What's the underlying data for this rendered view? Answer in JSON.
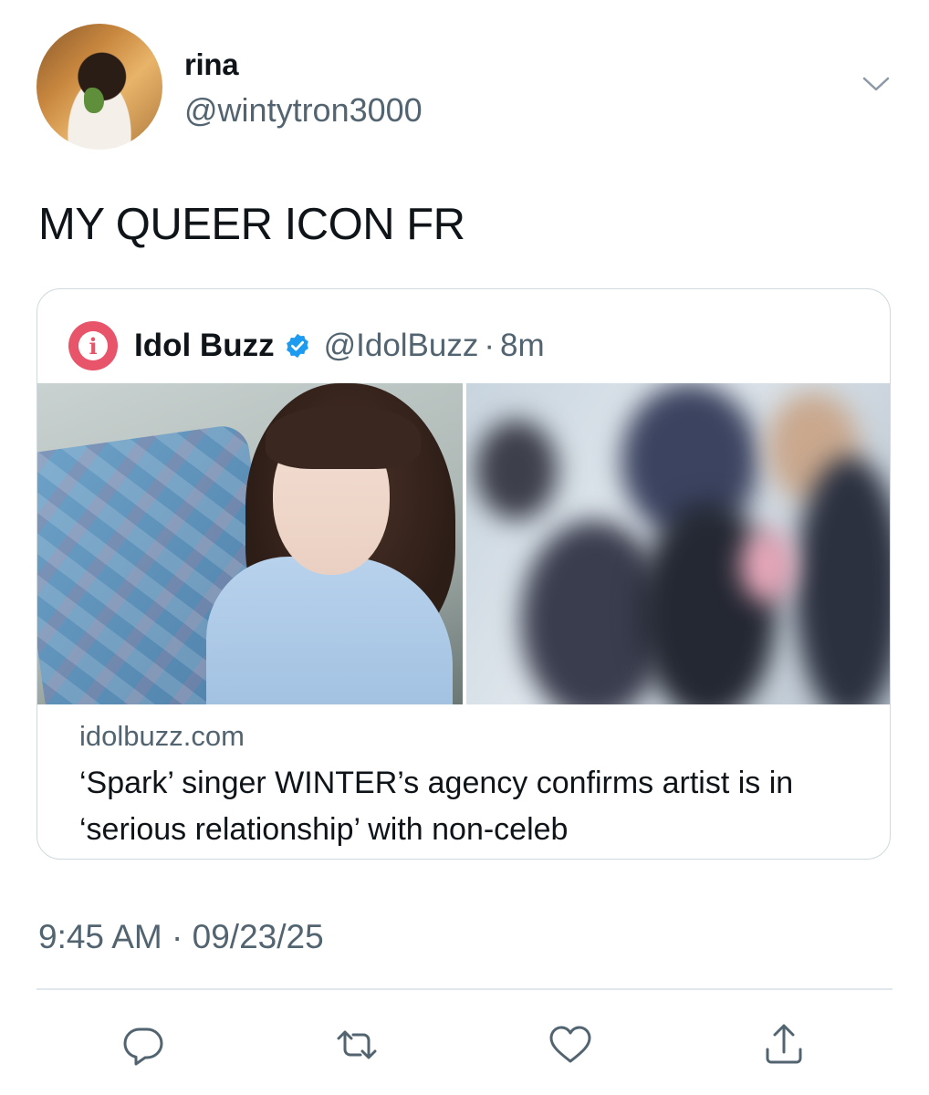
{
  "author": {
    "display_name": "rina",
    "handle": "@wintytron3000",
    "avatar": "profile-photo"
  },
  "tweet": {
    "text": "MY QUEER ICON FR",
    "timestamp": "9:45 AM · 09/23/25"
  },
  "quoted": {
    "logo_letter": "i",
    "name": "Idol Buzz",
    "verified": true,
    "handle": "@IdolBuzz",
    "separator": "·",
    "time": "8m",
    "link_source": "idolbuzz.com",
    "link_title": "‘Spark’ singer WINTER’s agency confirms artist is in ‘serious relationship’ with non-celeb"
  },
  "actions": {
    "icons": [
      "reply-icon",
      "retweet-icon",
      "like-icon",
      "share-icon"
    ]
  },
  "colors": {
    "text": "#0f1419",
    "secondary": "#536471",
    "verified": "#1d9bf0",
    "logo": "#e8546a",
    "border": "#cfd9de"
  }
}
